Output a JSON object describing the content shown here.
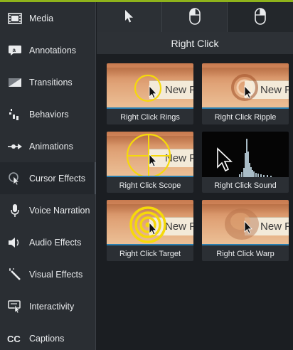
{
  "sidebar": {
    "items": [
      {
        "label": "Media",
        "icon": "film-strip-icon"
      },
      {
        "label": "Annotations",
        "icon": "annotation-icon"
      },
      {
        "label": "Transitions",
        "icon": "transition-icon"
      },
      {
        "label": "Behaviors",
        "icon": "behaviors-icon"
      },
      {
        "label": "Animations",
        "icon": "animation-arrow-icon"
      },
      {
        "label": "Cursor Effects",
        "icon": "cursor-effects-icon",
        "active": true
      },
      {
        "label": "Voice Narration",
        "icon": "microphone-icon"
      },
      {
        "label": "Audio Effects",
        "icon": "speaker-icon"
      },
      {
        "label": "Visual Effects",
        "icon": "magic-wand-icon"
      },
      {
        "label": "Interactivity",
        "icon": "interactivity-icon"
      },
      {
        "label": "Captions",
        "icon": "cc-icon"
      }
    ]
  },
  "tabs": [
    {
      "name": "cursor-tab",
      "icon": "arrow-cursor-icon"
    },
    {
      "name": "left-click-tab",
      "icon": "mouse-left-click-icon"
    },
    {
      "name": "right-click-tab",
      "icon": "mouse-right-click-icon",
      "active": true
    }
  ],
  "section": {
    "title": "Right Click"
  },
  "thumb_text": "New F",
  "effects": [
    {
      "label": "Right Click Rings"
    },
    {
      "label": "Right Click Ripple"
    },
    {
      "label": "Right Click Scope"
    },
    {
      "label": "Right Click Sound"
    },
    {
      "label": "Right Click Target"
    },
    {
      "label": "Right Click Warp"
    }
  ],
  "colors": {
    "accent": "#8fb31b",
    "effect_yellow": "#f5d90a",
    "sidebar_bg": "#2a2e33"
  }
}
